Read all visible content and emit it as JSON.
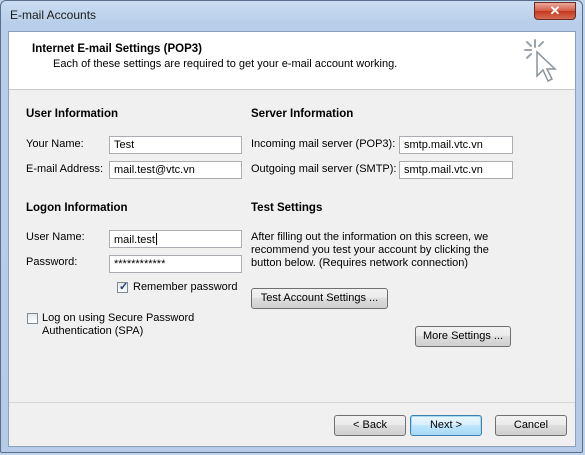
{
  "window": {
    "title": "E-mail Accounts",
    "close_label": "✕"
  },
  "header": {
    "title": "Internet E-mail Settings (POP3)",
    "subtitle": "Each of these settings are required to get your e-mail account working."
  },
  "user_info": {
    "heading": "User Information",
    "name_label": "Your Name:",
    "name_value": "Test",
    "email_label": "E-mail Address:",
    "email_value": "mail.test@vtc.vn"
  },
  "server_info": {
    "heading": "Server Information",
    "incoming_label": "Incoming mail server (POP3):",
    "incoming_value": "smtp.mail.vtc.vn",
    "outgoing_label": "Outgoing mail server (SMTP):",
    "outgoing_value": "smtp.mail.vtc.vn"
  },
  "logon_info": {
    "heading": "Logon Information",
    "username_label": "User Name:",
    "username_value": "mail.test",
    "password_label": "Password:",
    "password_value": "************",
    "remember_label": "Remember password",
    "remember_checked": true,
    "spa_label_line1": "Log on using Secure Password",
    "spa_label_line2": "Authentication (SPA)",
    "spa_checked": false
  },
  "test_settings": {
    "heading": "Test Settings",
    "line1": "After filling out the information on this screen, we",
    "line2": "recommend you test your account by clicking the",
    "line3": "button below. (Requires network connection)",
    "test_button": "Test Account Settings ..."
  },
  "more_settings_button": "More Settings ...",
  "footer": {
    "back": "< Back",
    "next": "Next >",
    "cancel": "Cancel"
  }
}
